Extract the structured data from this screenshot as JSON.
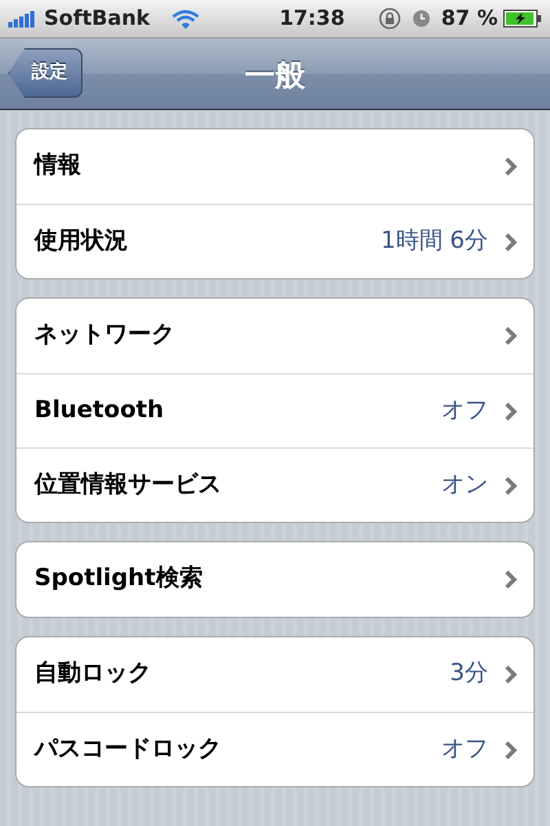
{
  "status_bar": {
    "carrier": "SoftBank",
    "time": "17:38",
    "battery": "87 %"
  },
  "nav_bar": {
    "back": "設定",
    "title": "一般"
  },
  "groups": [
    {
      "rows": [
        {
          "label": "情報"
        },
        {
          "label": "使用状況",
          "value": "1時間 6分"
        }
      ]
    },
    {
      "rows": [
        {
          "label": "ネットワーク"
        },
        {
          "label": "Bluetooth",
          "value": "オフ"
        },
        {
          "label": "位置情報サービス",
          "value": "オン"
        }
      ]
    },
    {
      "rows": [
        {
          "label": "Spotlight検索"
        }
      ]
    },
    {
      "rows": [
        {
          "label": "自動ロック",
          "value": "3分"
        },
        {
          "label": "パスコードロック",
          "value": "オフ"
        }
      ]
    }
  ]
}
